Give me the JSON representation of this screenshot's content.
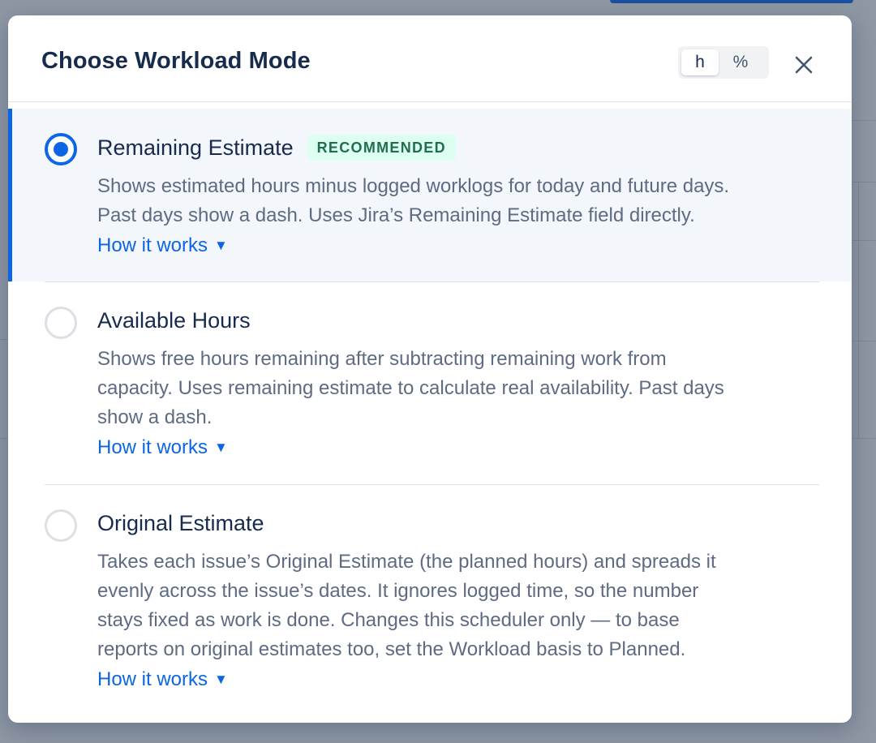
{
  "modal": {
    "title": "Choose Workload Mode",
    "unit_toggle": [
      {
        "label": "h",
        "active": true
      },
      {
        "label": "%",
        "active": false
      }
    ],
    "close_icon": "close-icon"
  },
  "options": [
    {
      "title": "Remaining Estimate",
      "badge": "RECOMMENDED",
      "selected": true,
      "desc_lines": [
        "Shows estimated hours minus logged worklogs for today and future days.",
        "Past days show a dash. Uses Jira’s Remaining Estimate field directly."
      ],
      "link": "How it works"
    },
    {
      "title": "Available Hours",
      "selected": false,
      "desc_lines": [
        "Shows free hours remaining after subtracting remaining work from",
        "capacity. Uses remaining estimate to calculate real availability. Past days",
        "show a dash."
      ],
      "link": "How it works"
    },
    {
      "title": "Original Estimate",
      "selected": false,
      "desc_lines": [
        "Takes each issue’s Original Estimate (the planned hours) and spreads it",
        "evenly across the issue’s dates. It ignores logged time, so the number",
        "stays fixed as work is done. Changes this scheduler only — to base",
        "reports on original estimates too, set the Workload basis to Planned."
      ],
      "link": "How it works",
      "link_caret": "▼"
    }
  ],
  "colors": {
    "accent": "#0c66e4",
    "badge_bg": "#dcfff1",
    "badge_text": "#216e4e",
    "title_text": "#172b4d"
  }
}
